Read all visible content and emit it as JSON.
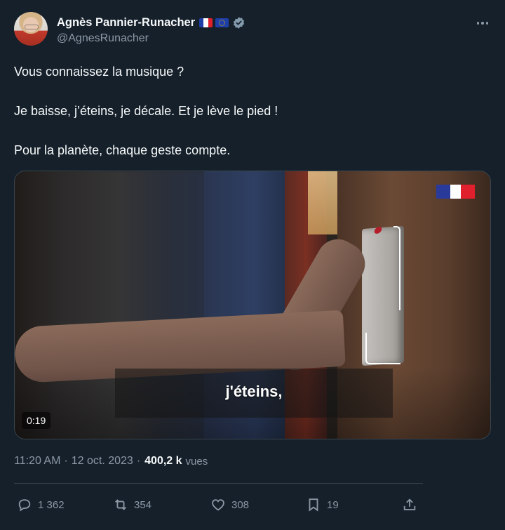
{
  "author": {
    "display_name": "Agnès Pannier-Runacher",
    "handle": "@AgnesRunacher",
    "flags": [
      "france-flag-icon",
      "eu-flag-icon"
    ],
    "verified": "verified-badge-icon"
  },
  "tweet": {
    "lines": [
      "Vous connaissez la musique ?",
      "Je baisse, j’éteins, je décale. Et je lève le pied !",
      "Pour la planète, chaque geste compte."
    ]
  },
  "media": {
    "subtitle": "j'éteins,",
    "duration": "0:19",
    "logo": "republique-francaise-logo"
  },
  "meta": {
    "time": "11:20 AM",
    "separator": "·",
    "date": "12 oct. 2023",
    "views_count": "400,2 k",
    "views_label": "vues"
  },
  "actions": {
    "replies": "1 362",
    "reposts": "354",
    "likes": "308",
    "bookmarks": "19"
  },
  "colors": {
    "background": "#15202b",
    "text": "#f7f9f9",
    "secondary": "#8b98a5",
    "border": "#38444d"
  }
}
